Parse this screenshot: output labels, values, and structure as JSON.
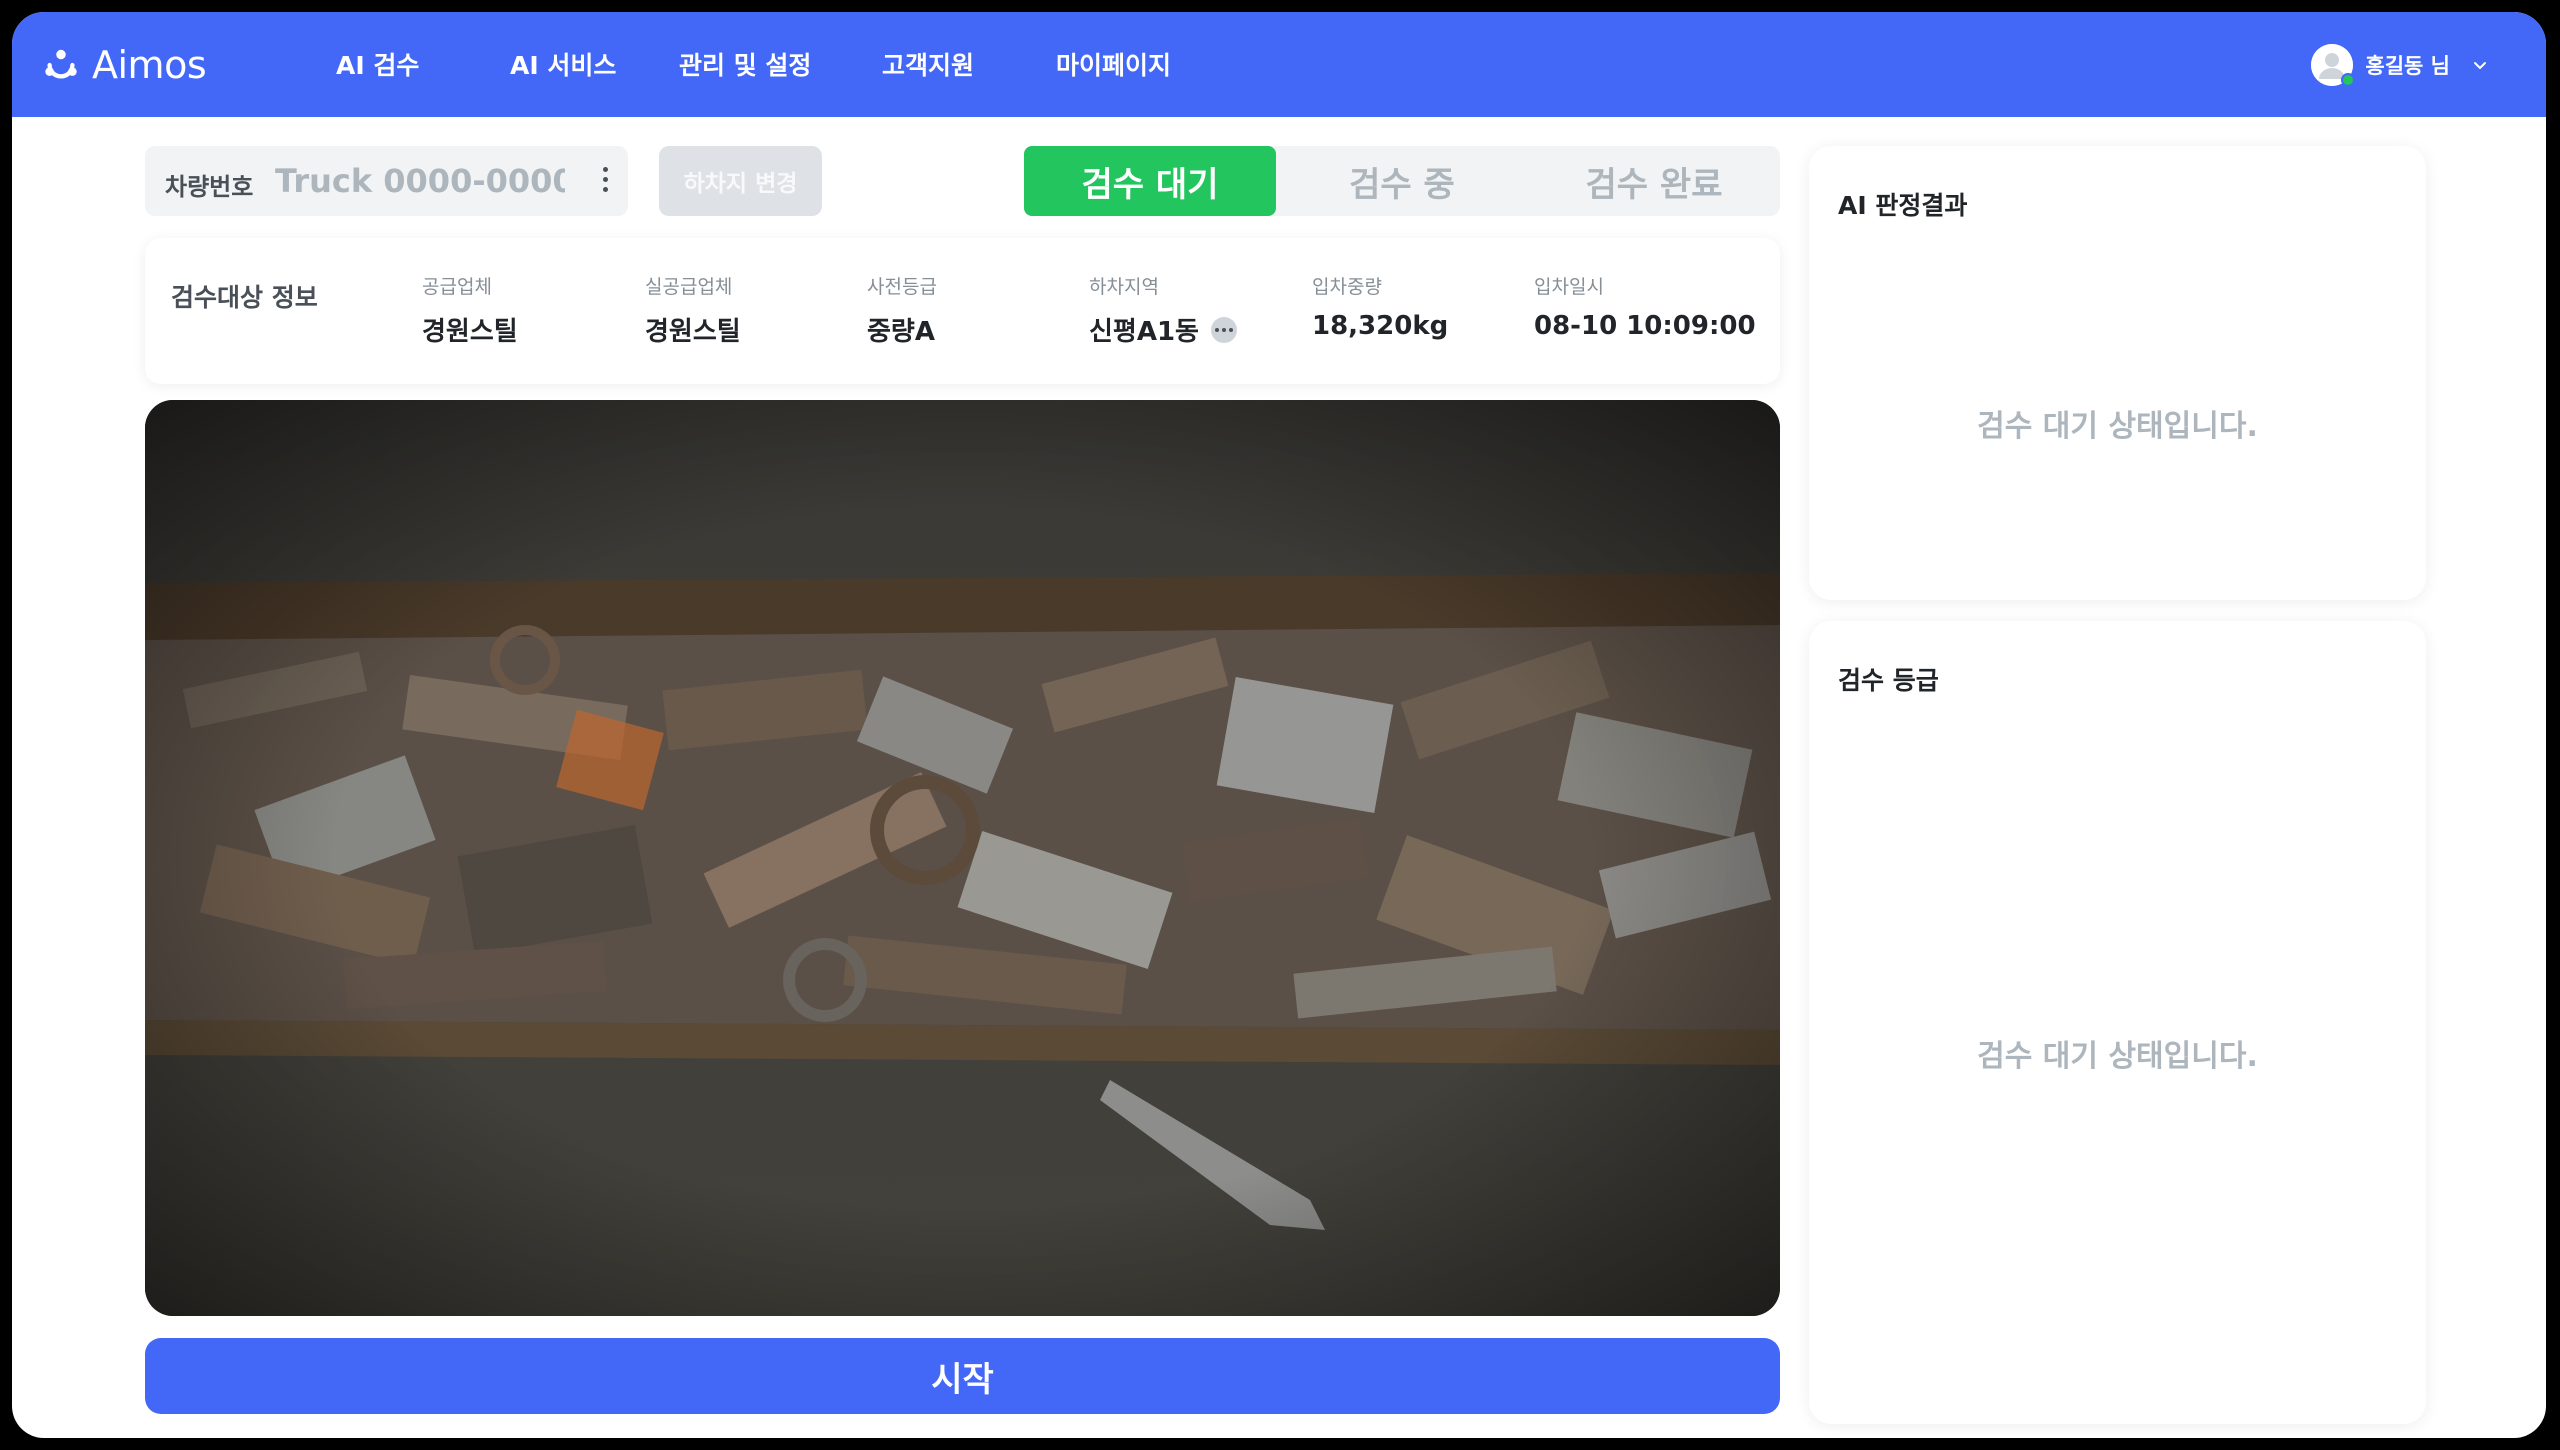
{
  "brand": {
    "name": "Aimos"
  },
  "nav": {
    "items": [
      "AI 검수",
      "AI 서비스",
      "관리 및 설정",
      "고객지원",
      "마이페이지"
    ]
  },
  "user": {
    "name": "홍길동 님",
    "status_color": "#22c55e"
  },
  "truck": {
    "label": "차량번호",
    "placeholder": "Truck 0000-0000"
  },
  "unload_button": "하차지 변경",
  "status_tabs": [
    {
      "label": "검수 대기",
      "active": true
    },
    {
      "label": "검수 중",
      "active": false
    },
    {
      "label": "검수 완료",
      "active": false
    }
  ],
  "info": {
    "title": "검수대상 정보",
    "fields": [
      {
        "label": "공급업체",
        "value": "경원스틸"
      },
      {
        "label": "실공급업체",
        "value": "경원스틸"
      },
      {
        "label": "사전등급",
        "value": "중량A"
      },
      {
        "label": "하차지역",
        "value": "신평A1동"
      },
      {
        "label": "입차중량",
        "value": "18,320kg"
      },
      {
        "label": "입차일시",
        "value": "08-10 10:09:00"
      }
    ]
  },
  "start_button": "시작",
  "ai_result_panel": {
    "title": "AI 판정결과",
    "message": "검수 대기 상태입니다."
  },
  "grade_panel": {
    "title": "검수 등급",
    "message": "검수 대기 상태입니다."
  },
  "colors": {
    "primary": "#4368f7",
    "success": "#22c55e",
    "muted": "#adb5bd"
  }
}
